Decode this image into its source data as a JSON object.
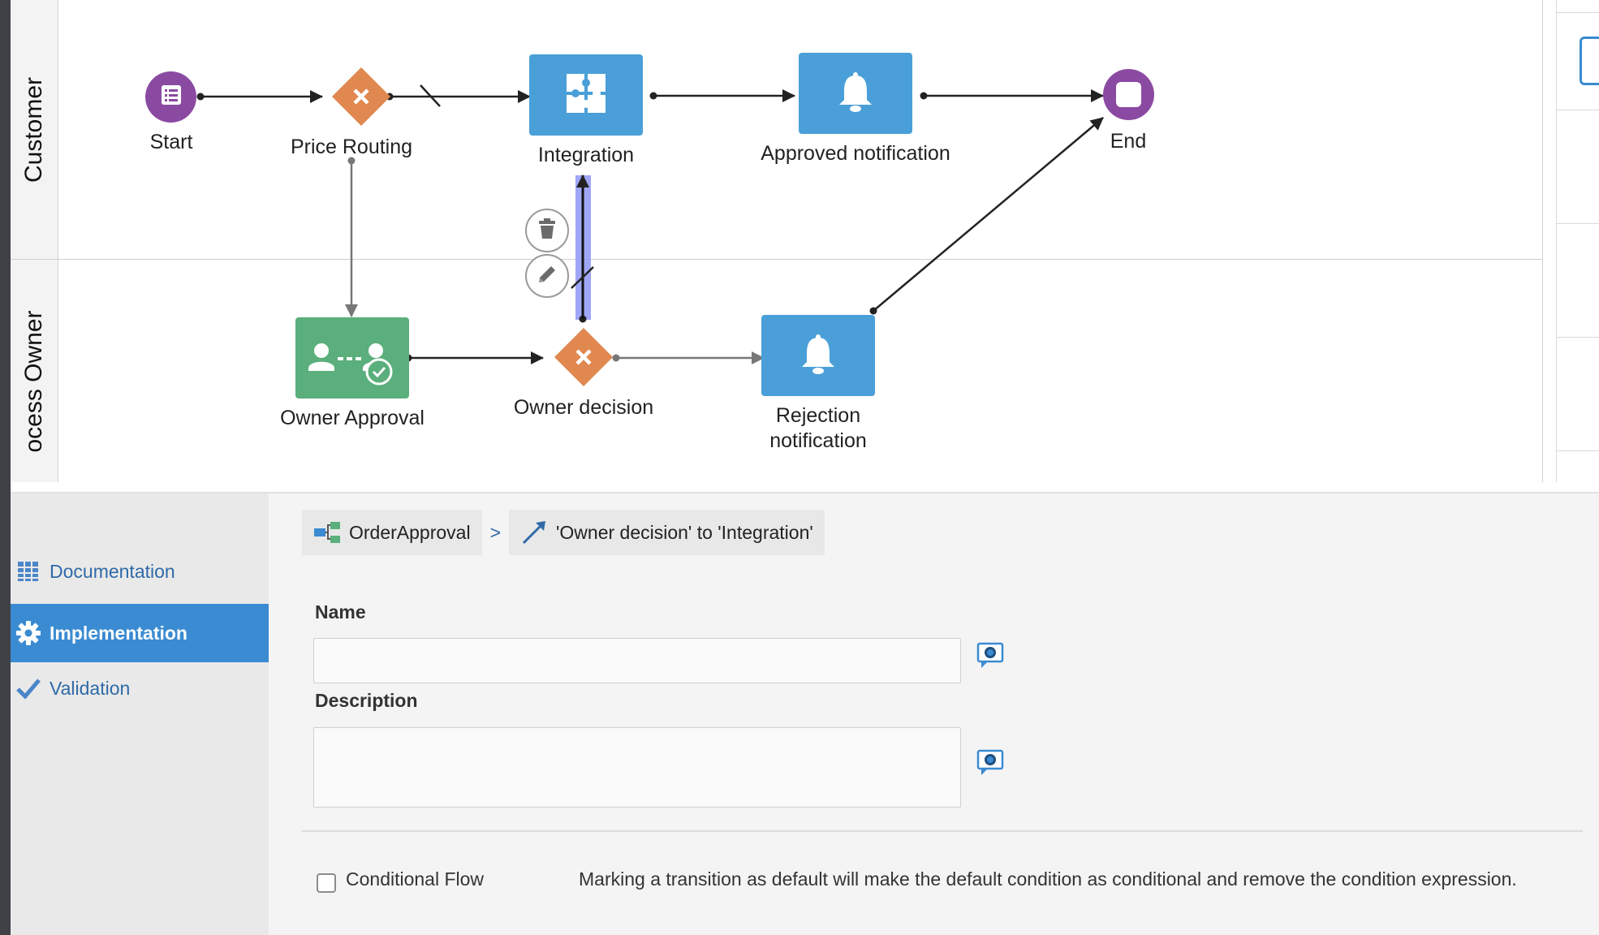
{
  "lanes": {
    "customer": "Customer",
    "owner": "ocess Owner"
  },
  "nodes": {
    "start": "Start",
    "price_routing": "Price Routing",
    "integration": "Integration",
    "approved_notification": "Approved notification",
    "end": "End",
    "owner_approval": "Owner Approval",
    "owner_decision": "Owner decision",
    "rejection_notification": "Rejection notification"
  },
  "colors": {
    "event_purple": "#8a4aa2",
    "gateway_orange": "#e0884f",
    "task_blue": "#4a9fd8",
    "task_green": "#5aaf7c",
    "selection": "#8f96f5",
    "nav_active": "#3a8bd2",
    "link_blue": "#2f6aa8"
  },
  "side_nav": {
    "items": [
      {
        "label": "Documentation",
        "icon": "columns-icon"
      },
      {
        "label": "Implementation",
        "icon": "gear-icon",
        "active": true
      },
      {
        "label": "Validation",
        "icon": "checkmark-icon"
      }
    ]
  },
  "breadcrumb": {
    "root": "OrderApproval",
    "separator": ">",
    "current": "'Owner decision' to 'Integration'"
  },
  "form": {
    "name_label": "Name",
    "name_value": "",
    "description_label": "Description",
    "description_value": "",
    "conditional_flow_label": "Conditional Flow",
    "conditional_flow_checked": false,
    "help_text": "Marking a transition as default will make the default condition as conditional and remove the condition expression."
  }
}
